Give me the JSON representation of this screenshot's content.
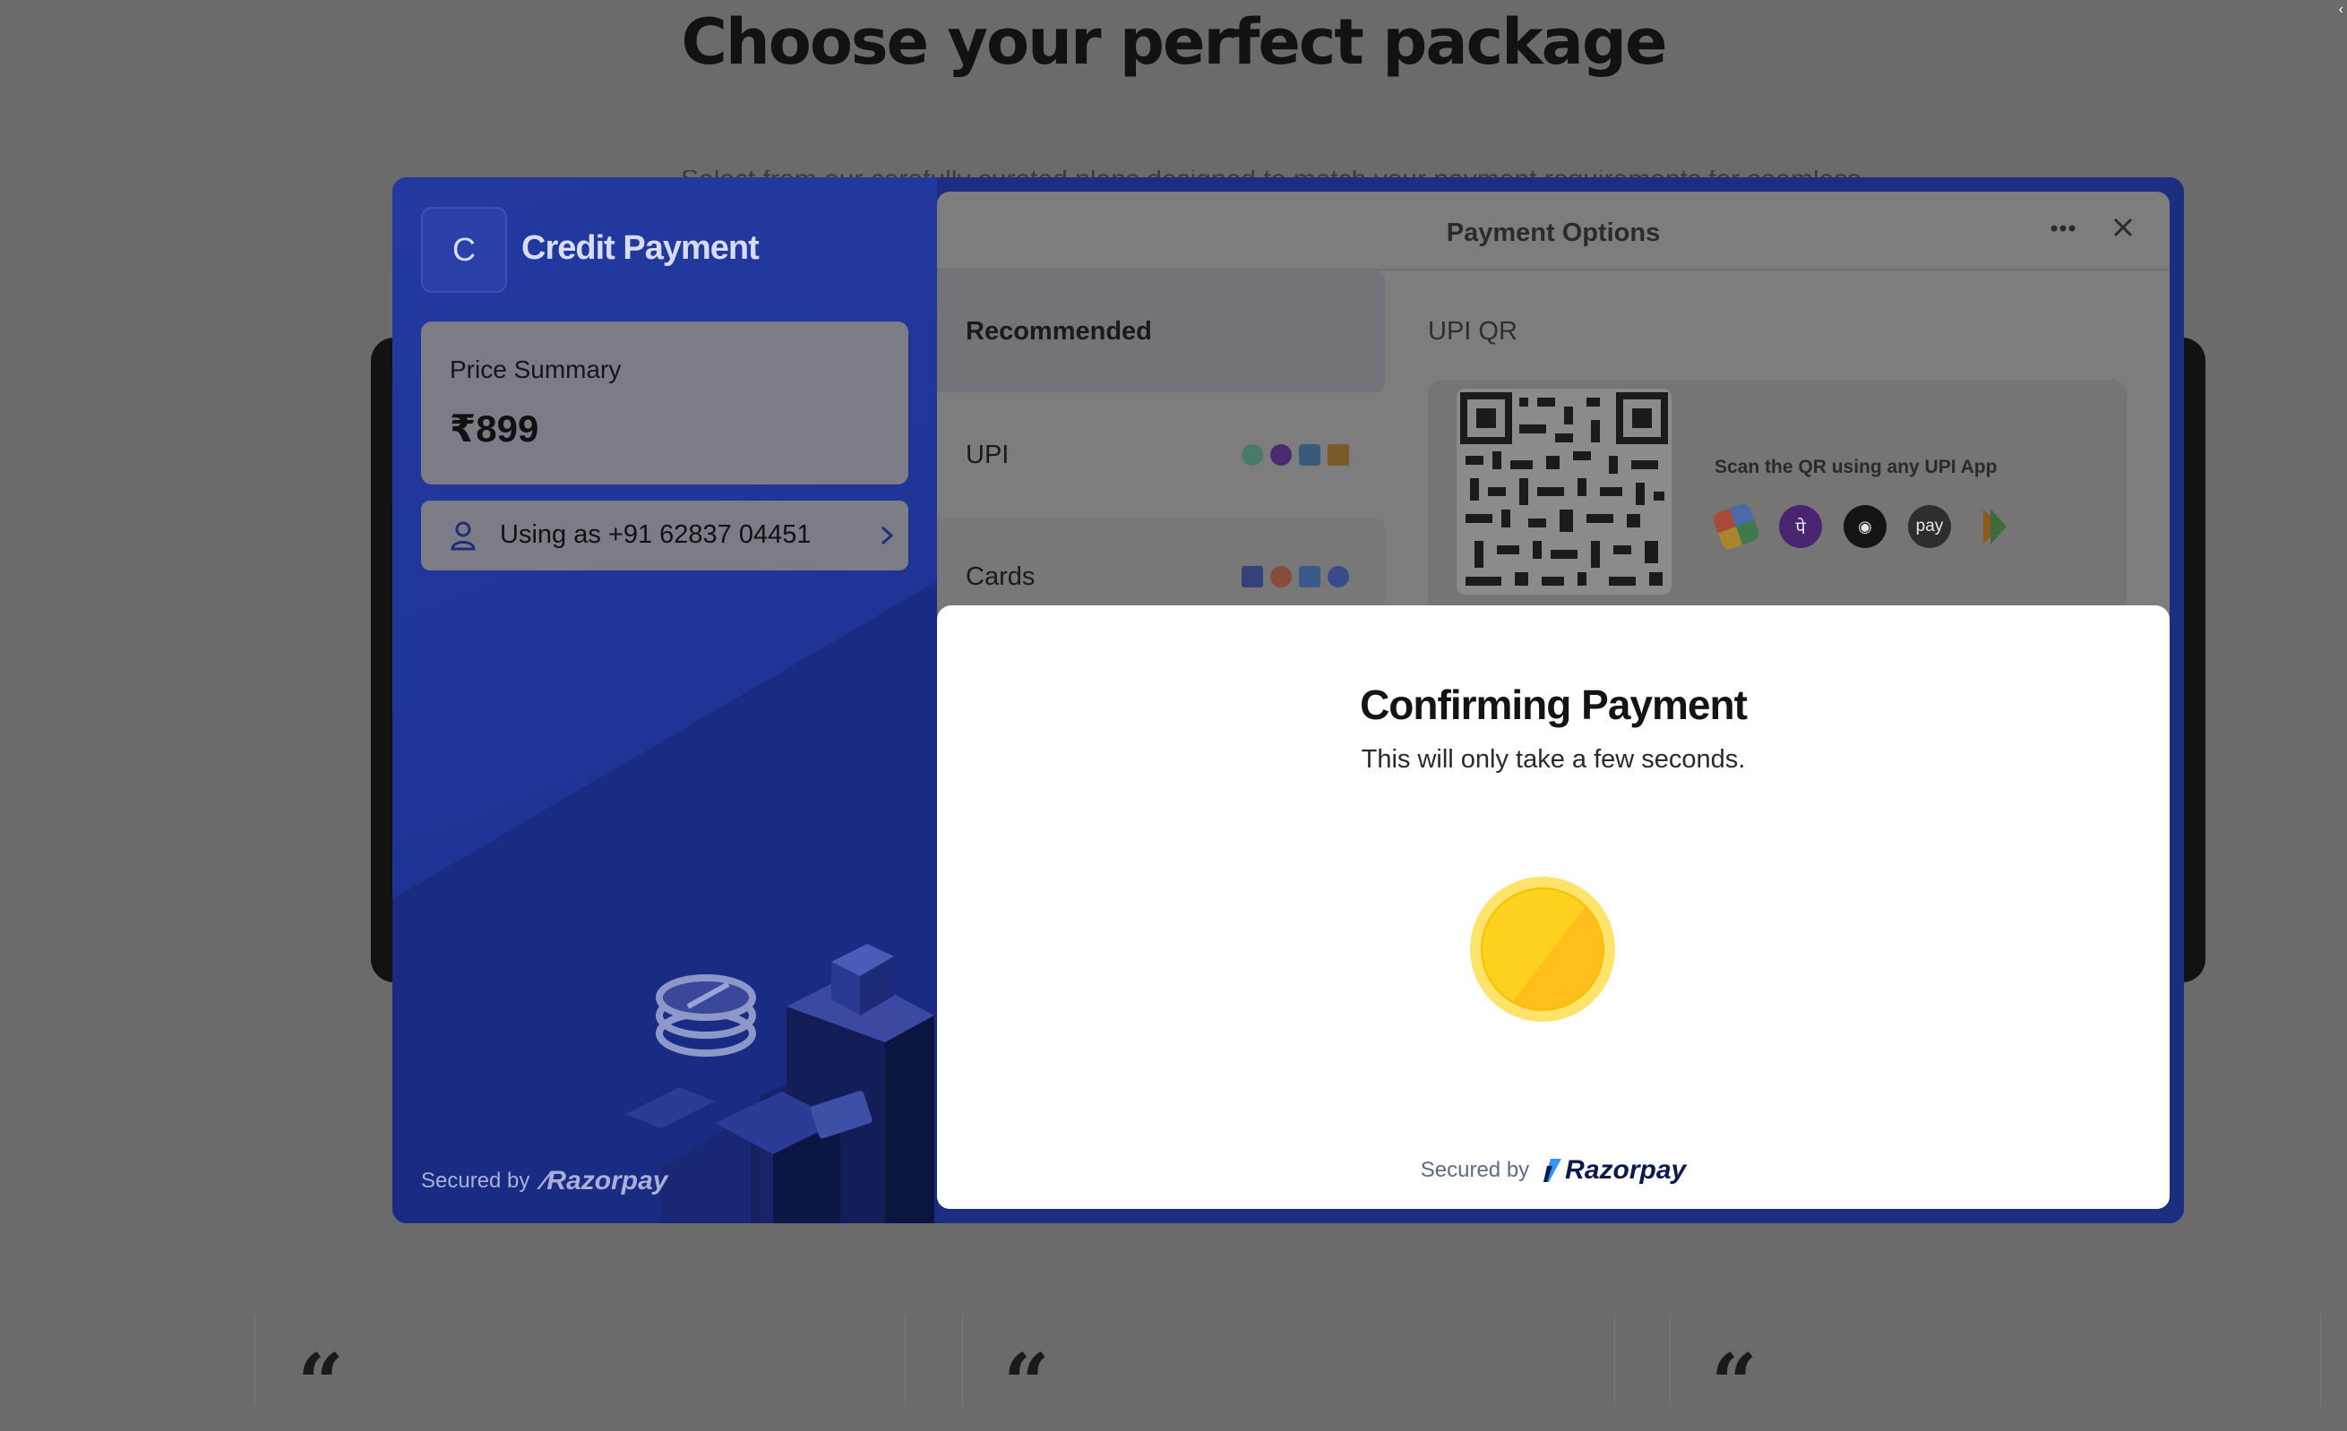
{
  "page": {
    "title": "Choose your perfect package",
    "subtitle_partial": "Select from our carefully curated plans designed to match your payment requirements for seamless checkout"
  },
  "checkout": {
    "merchant_initial": "C",
    "merchant_name": "Credit Payment",
    "price_summary_label": "Price Summary",
    "price": "₹899",
    "user_label": "Using as +91 62837 04451",
    "secured_by": "Secured by",
    "brand": "Razorpay",
    "payment_options_title": "Payment Options",
    "methods": [
      {
        "label": "Recommended",
        "icons": []
      },
      {
        "label": "UPI",
        "icons": [
          "gpay-icon",
          "phonepe-icon",
          "paytm-icon",
          "bhim-icon"
        ]
      },
      {
        "label": "Cards",
        "icons": [
          "visa-icon",
          "mastercard-icon",
          "rupay-icon",
          "maestro-icon"
        ]
      }
    ],
    "upi_qr_label": "UPI QR",
    "qr_hint": "Scan the QR using any UPI App",
    "qr_apps": [
      "gpay-icon",
      "phonepe-icon",
      "cred-icon",
      "amazon-pay-icon",
      "bhim-icon"
    ],
    "qr_app_glyphs": {
      "phonepe": "पे",
      "cred": "◉",
      "amazon": "pay"
    },
    "confirming_title": "Confirming Payment",
    "confirming_subtitle": "This will only take a few seconds."
  },
  "colors": {
    "modal_bg": "#1c2e80",
    "overlay_bg": "#ffffff",
    "coin": "#ffd21f"
  }
}
